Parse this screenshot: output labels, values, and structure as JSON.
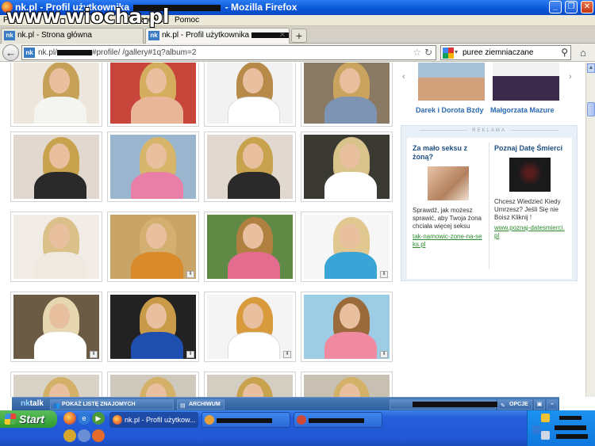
{
  "window": {
    "title_prefix": "nk.pl - Profil użytkownika",
    "title_suffix": "- Mozilla Firefox",
    "watermark": "www.wiocha.pl",
    "controls": [
      "_",
      "❐",
      "✕"
    ]
  },
  "menu": {
    "items": [
      "Plik",
      "rzędzia",
      "Pomoc"
    ]
  },
  "tabs": [
    {
      "label": "nk.pl - Strona główna",
      "icon": "nk"
    },
    {
      "label": "nk.pl - Profil użytkownika",
      "icon": "nk"
    }
  ],
  "newtab_label": "+",
  "nav": {
    "back_label": "←",
    "url_prefix": "nk.pl/",
    "url_suffix": "#profile/                /gallery#1q?album=2",
    "site_icon": "nk",
    "search_query": "puree ziemniaczane",
    "home_label": "⌂"
  },
  "friends": [
    {
      "name": "Darek i Dorota Bzdy"
    },
    {
      "name": "Małgorzata Mazure"
    }
  ],
  "reklama": {
    "header": "REKLAMA",
    "ads": [
      {
        "title": "Za mało seksu z żoną?",
        "desc": "Sprawdź, jak możesz sprawić, aby Twoja żona chciała więcej seksu",
        "link": "tak-namowic-zone-na-seks.pl"
      },
      {
        "title": "Poznaj Datę Śmierci",
        "desc": "Chcesz Wiedzieć Kiedy Umrzesz? Jeśli Się nie Boisz Kliknij !",
        "link": "www.poznaj-datesmierci.pl"
      }
    ]
  },
  "nktalk": {
    "logo_nk": "nk",
    "logo_talk": "talk",
    "show_friends": "POKAŻ LISTĘ ZNAJOMYCH",
    "archive": "ARCHIWUM",
    "options": "OPCJE"
  },
  "taskbar": {
    "start_label": "Start",
    "items": [
      {
        "label": "nk.pl - Profil użytkow..."
      },
      {
        "label": ""
      },
      {
        "label": ""
      }
    ]
  },
  "colors": {
    "titlebar": "#0a55d6",
    "link": "#2a6ab3",
    "ad_link": "#2e8b2e",
    "nktalk_bar": "#3c6aa8",
    "taskbar": "#245edb",
    "start_green": "#3fa83f"
  }
}
